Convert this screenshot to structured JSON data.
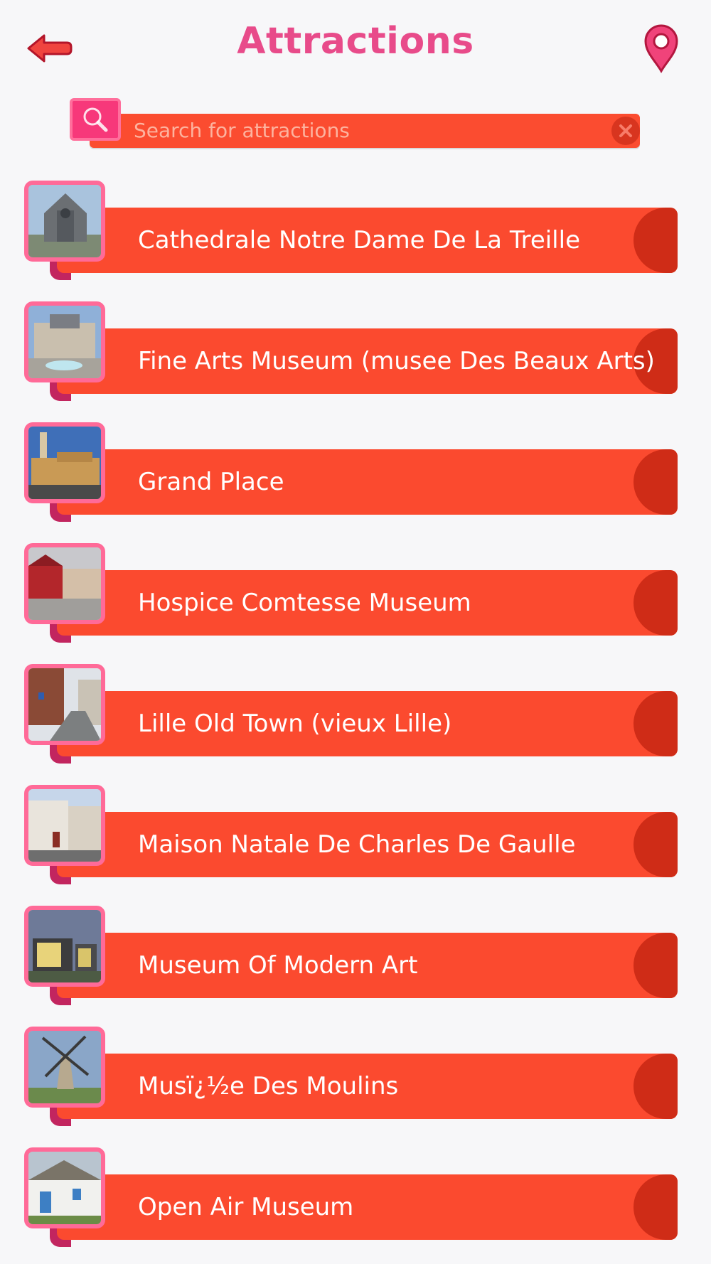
{
  "header": {
    "title": "Attractions",
    "back_icon": "back-arrow-icon",
    "map_icon": "map-pin-icon"
  },
  "search": {
    "placeholder": "Search for attractions",
    "search_icon": "search-icon",
    "clear_icon": "close-icon"
  },
  "colors": {
    "accent_pink": "#e84b8a",
    "bar_orange": "#fb4a2f",
    "bar_end": "#cf2c17",
    "thumb_border": "#ff6a98"
  },
  "attractions": [
    {
      "label": "Cathedrale Notre Dame De La Treille"
    },
    {
      "label": "Fine Arts Museum (musee Des Beaux Arts)"
    },
    {
      "label": "Grand Place"
    },
    {
      "label": "Hospice Comtesse Museum"
    },
    {
      "label": "Lille Old Town (vieux Lille)"
    },
    {
      "label": "Maison Natale De Charles De Gaulle"
    },
    {
      "label": "Museum Of Modern Art"
    },
    {
      "label": "Musï¿½e Des Moulins"
    },
    {
      "label": "Open Air Museum"
    }
  ]
}
